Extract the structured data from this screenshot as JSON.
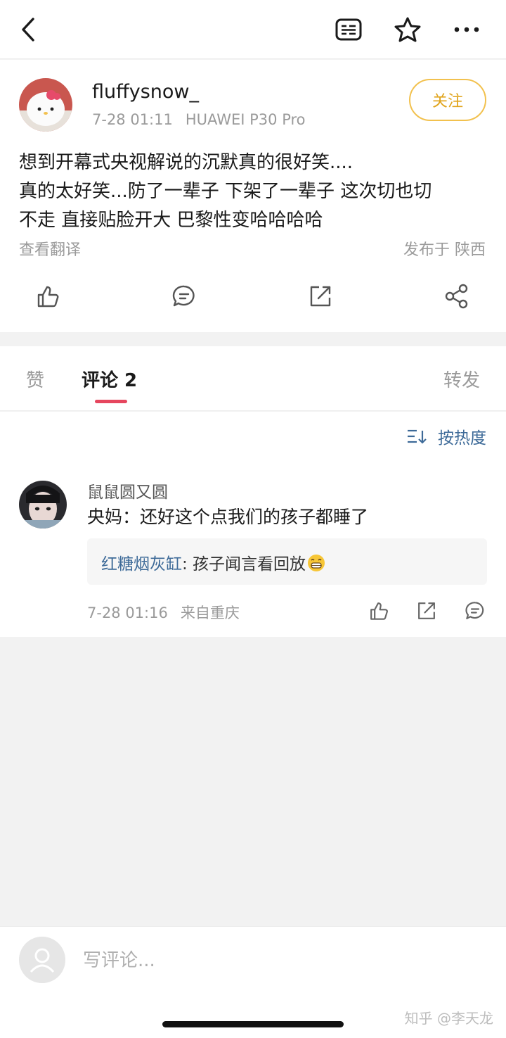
{
  "nav": {
    "icons": [
      "back-icon",
      "reader-icon",
      "star-icon",
      "more-icon"
    ]
  },
  "post": {
    "author": "fluffysnow_",
    "time": "7-28 01:11",
    "device": "HUAWEI P30 Pro",
    "follow_label": "关注",
    "text_lines": [
      "想到开幕式央视解说的沉默真的很好笑....",
      "真的太好笑...防了一辈子 下架了一辈子 这次切也切",
      "不走 直接贴脸开大 巴黎性变哈哈哈哈"
    ],
    "translate_label": "查看翻译",
    "location": "发布于 陕西"
  },
  "tabs": {
    "likes": "赞",
    "comments": "评论 2",
    "reposts": "转发"
  },
  "comments": {
    "sort_label": "按热度",
    "items": [
      {
        "user": "鼠鼠圆又圆",
        "text": "央妈：还好这个点我们的孩子都睡了",
        "reply_user": "红糖烟灰缸",
        "reply_text": ": 孩子闻言看回放",
        "time": "7-28 01:16",
        "from": "来自重庆"
      }
    ]
  },
  "bottom": {
    "placeholder": "写评论...",
    "watermark": "知乎 @李天龙"
  },
  "colors": {
    "accent_follow": "#e0a41c",
    "tab_indicator": "#e6465e",
    "link_blue": "#3d6a98"
  }
}
